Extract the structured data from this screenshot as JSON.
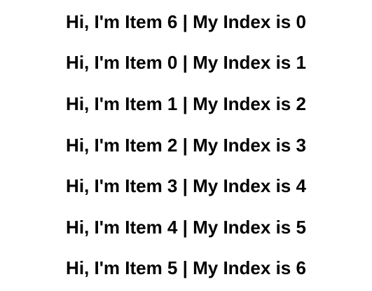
{
  "items": [
    {
      "text": "Hi, I'm Item 6 | My Index is 0"
    },
    {
      "text": "Hi, I'm Item 0 | My Index is 1"
    },
    {
      "text": "Hi, I'm Item 1 | My Index is 2"
    },
    {
      "text": "Hi, I'm Item 2 | My Index is 3"
    },
    {
      "text": "Hi, I'm Item 3 | My Index is 4"
    },
    {
      "text": "Hi, I'm Item 4 | My Index is 5"
    },
    {
      "text": "Hi, I'm Item 5 | My Index is 6"
    }
  ]
}
